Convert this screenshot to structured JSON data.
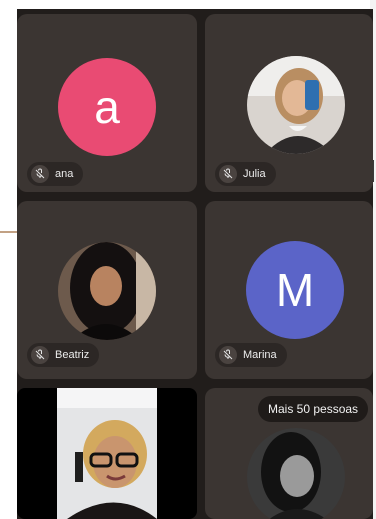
{
  "participants": [
    {
      "name": "ana",
      "avatar_letter": "a",
      "avatar_color": "#e94b73",
      "muted": true
    },
    {
      "name": "Julia",
      "muted": true
    },
    {
      "name": "Beatriz",
      "muted": true
    },
    {
      "name": "Marina",
      "avatar_letter": "M",
      "avatar_color": "#5b64c8",
      "muted": true
    }
  ],
  "more_badge": "Mais 50 pessoas",
  "icons": {
    "muted": "mic-off-icon"
  }
}
